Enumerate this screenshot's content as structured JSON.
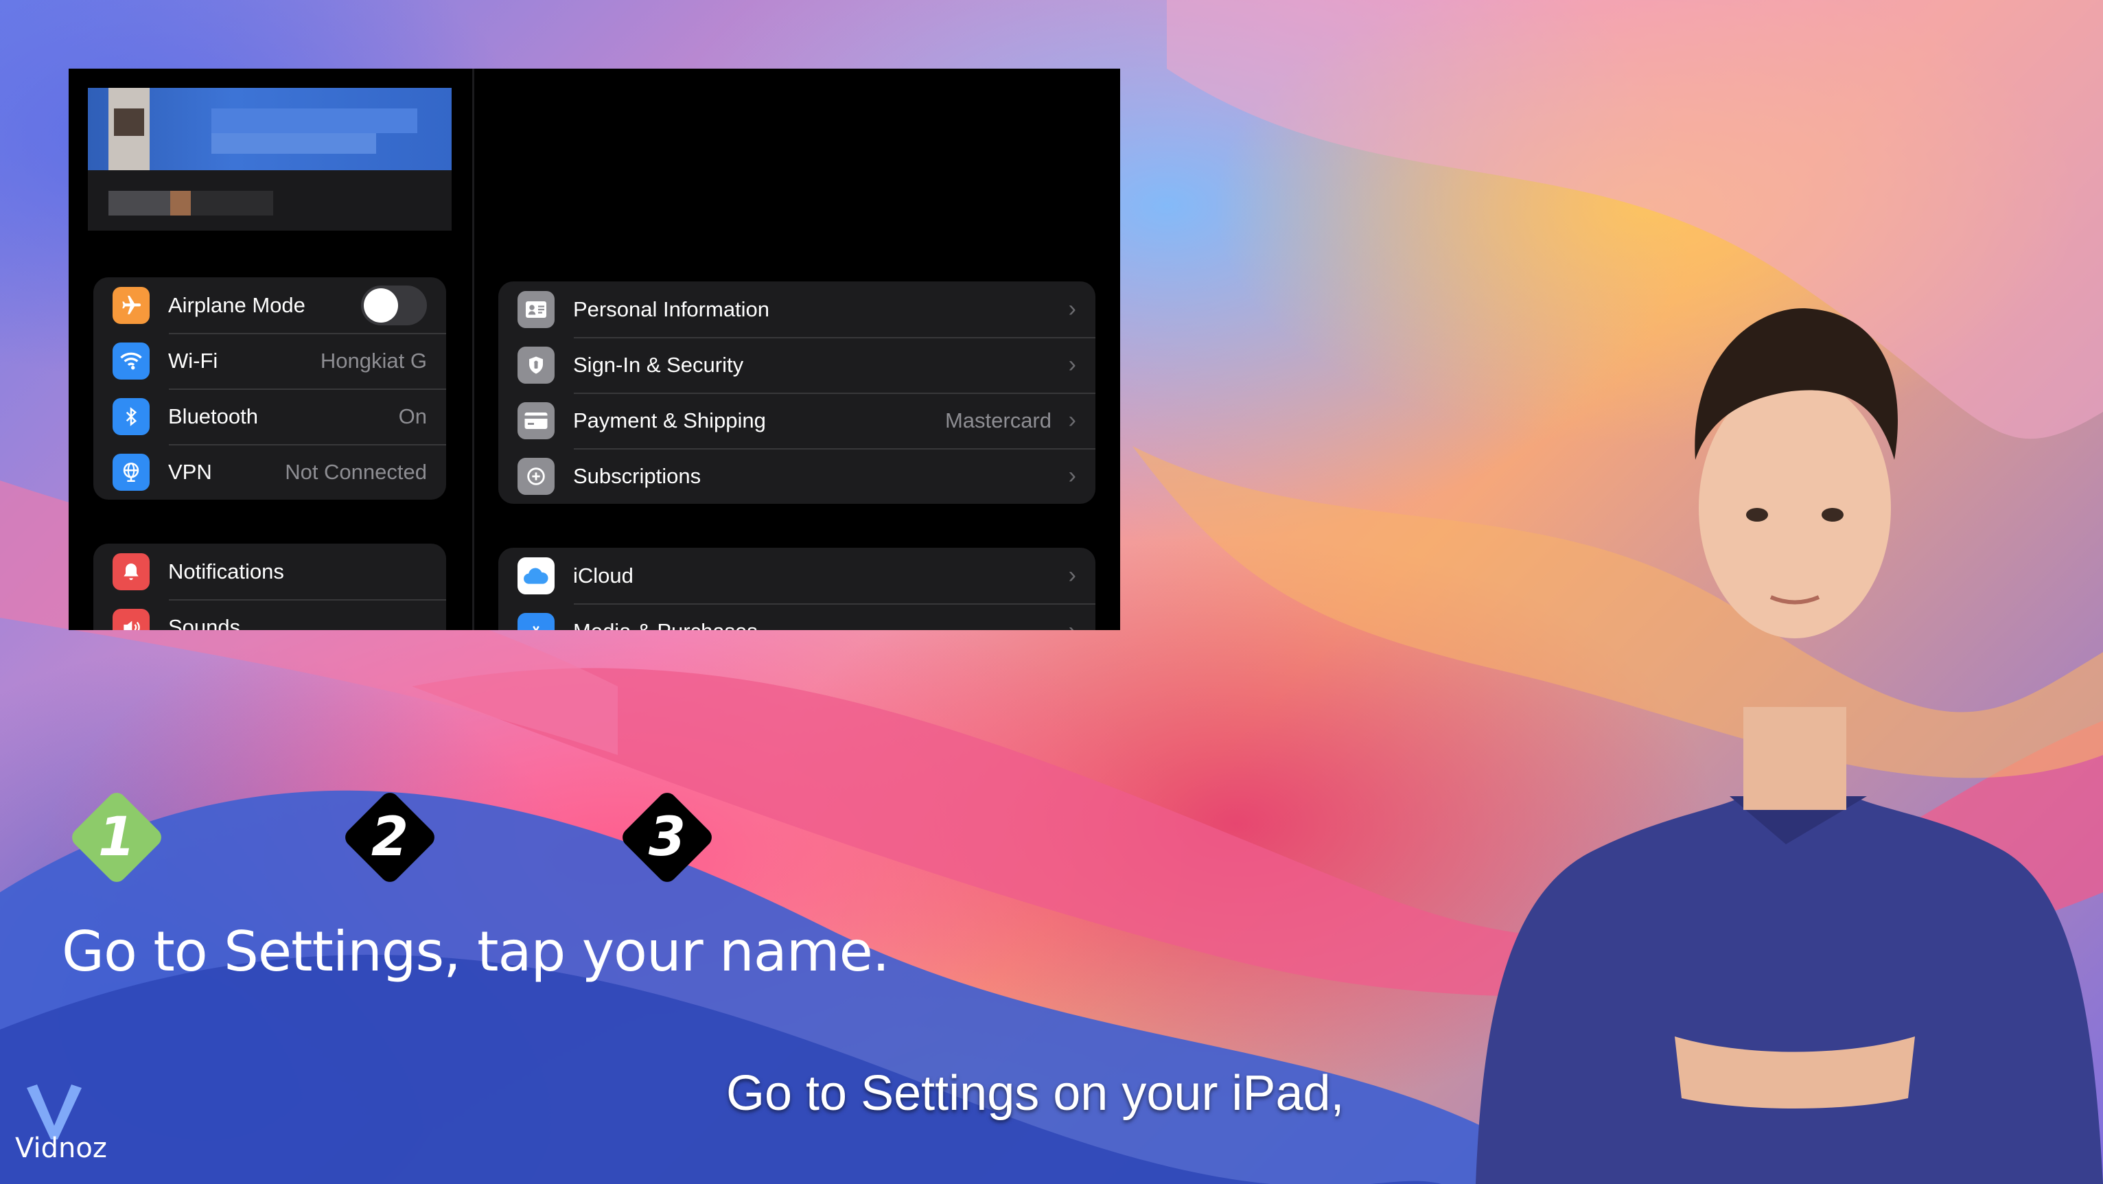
{
  "settings": {
    "sidebar": {
      "group1": [
        {
          "label": "Airplane Mode",
          "icon": "airplane-icon",
          "color": "#F7993B",
          "toggle": "off"
        },
        {
          "label": "Wi-Fi",
          "value": "Hongkiat G",
          "icon": "wifi-icon",
          "color": "#2F8CF5"
        },
        {
          "label": "Bluetooth",
          "value": "On",
          "icon": "bluetooth-icon",
          "color": "#2F8CF5"
        },
        {
          "label": "VPN",
          "value": "Not Connected",
          "icon": "globe-icon",
          "color": "#2F8CF5"
        }
      ],
      "group2": [
        {
          "label": "Notifications",
          "icon": "bell-icon",
          "color": "#EB4D4D"
        },
        {
          "label": "Sounds",
          "icon": "speaker-icon",
          "color": "#EB4D4D"
        }
      ]
    },
    "detail": {
      "group1": [
        {
          "label": "Personal Information",
          "icon": "id-card-icon"
        },
        {
          "label": "Sign-In & Security",
          "icon": "shield-icon"
        },
        {
          "label": "Payment & Shipping",
          "value": "Mastercard",
          "icon": "credit-card-icon"
        },
        {
          "label": "Subscriptions",
          "icon": "subscription-icon"
        }
      ],
      "group2": [
        {
          "label": "iCloud",
          "icon": "cloud-icon"
        },
        {
          "label": "Media & Purchases",
          "icon": "app-store-icon"
        }
      ]
    }
  },
  "steps": [
    {
      "number": "1",
      "color": "#8DCB6A"
    },
    {
      "number": "2",
      "color": "#000000"
    },
    {
      "number": "3",
      "color": "#000000"
    }
  ],
  "caption": "Go to Settings, tap your name.",
  "subtitle": "Go to Settings on your iPad,",
  "brand": "Vidnoz"
}
